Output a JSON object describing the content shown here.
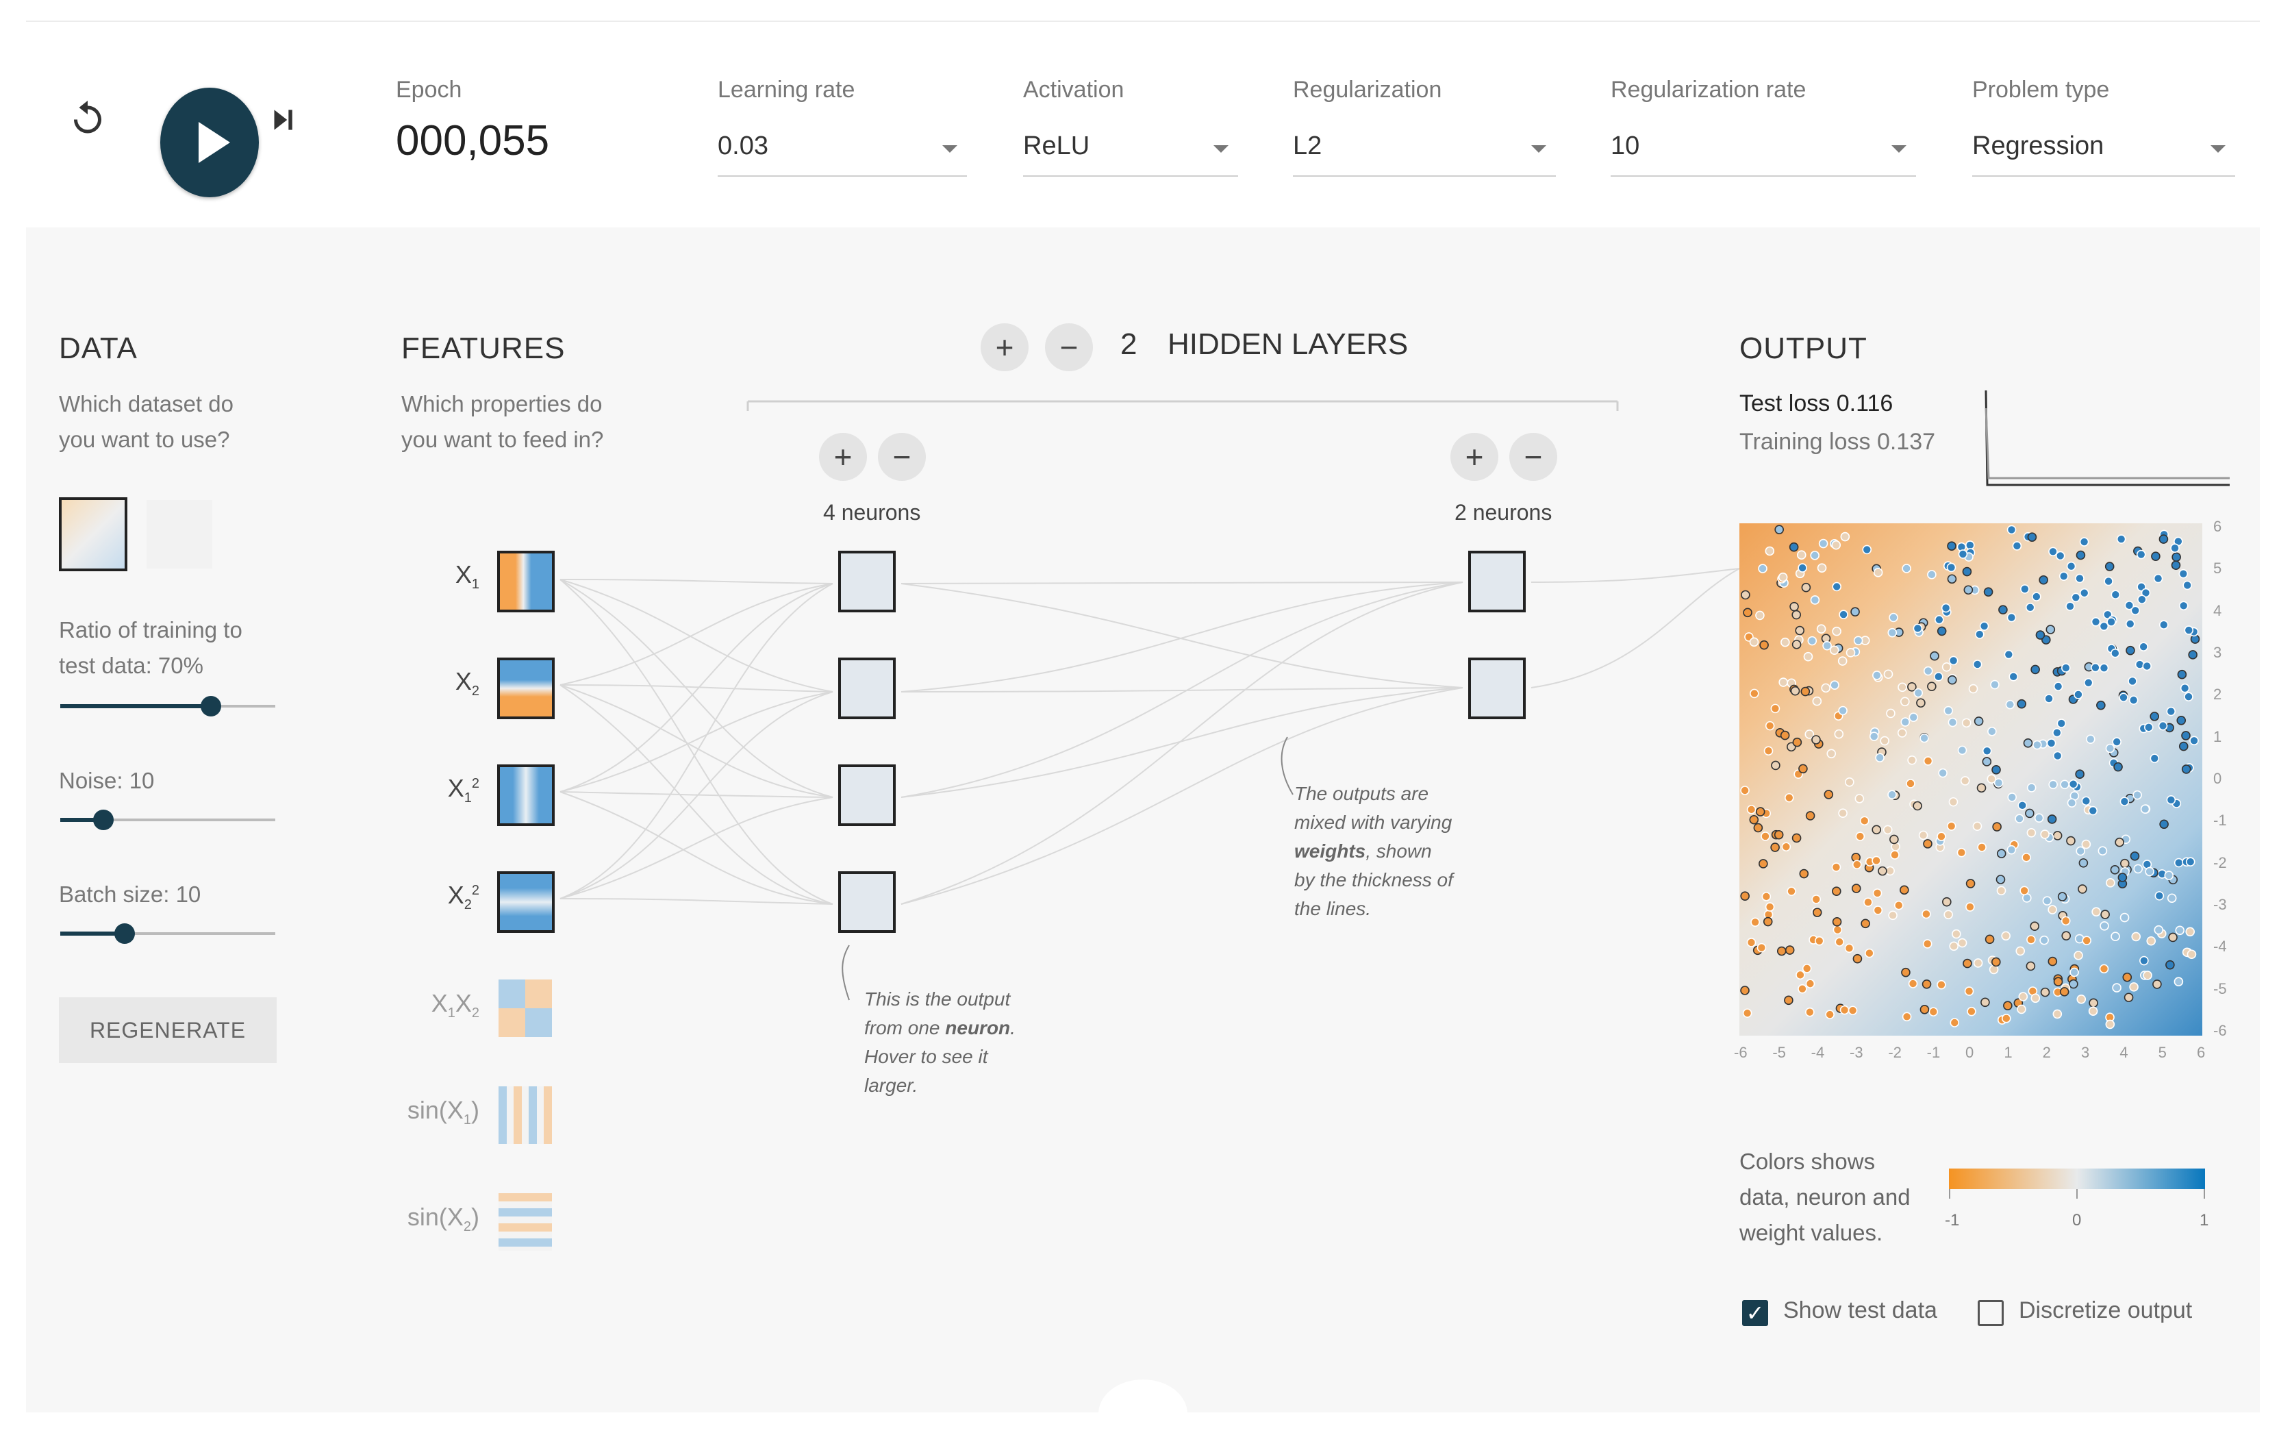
{
  "controls": {
    "epoch_label": "Epoch",
    "epoch_value": "000,055",
    "learning_rate": {
      "label": "Learning rate",
      "value": "0.03"
    },
    "activation": {
      "label": "Activation",
      "value": "ReLU"
    },
    "regularization": {
      "label": "Regularization",
      "value": "L2"
    },
    "regularization_rate": {
      "label": "Regularization rate",
      "value": "10"
    },
    "problem_type": {
      "label": "Problem type",
      "value": "Regression"
    }
  },
  "data_panel": {
    "title": "DATA",
    "question_line1": "Which dataset do",
    "question_line2": "you want to use?",
    "ratio_line1": "Ratio of training to",
    "ratio_line2": "test data:  70%",
    "ratio_value": 0.7,
    "noise_label": "Noise:  10",
    "noise_value": 0.2,
    "batch_label": "Batch size:  10",
    "batch_value": 0.3,
    "regenerate_label": "REGENERATE"
  },
  "features_panel": {
    "title": "FEATURES",
    "question_line1": "Which properties do",
    "question_line2": "you want to feed in?"
  },
  "network": {
    "add_layer": "+",
    "remove_layer": "−",
    "layer_count": "2",
    "layers_label": "HIDDEN LAYERS",
    "layer1_neurons": "4 neurons",
    "layer2_neurons": "2 neurons",
    "note_neuron_1": "This is the output",
    "note_neuron_2": "from one neuron.",
    "note_neuron_3": "Hover to see it",
    "note_neuron_4": "larger.",
    "note_weights_1": "The outputs are",
    "note_weights_2": "mixed with varying",
    "note_weights_3": "weights, shown",
    "note_weights_4": "by the thickness of",
    "note_weights_5": "the lines."
  },
  "output_panel": {
    "title": "OUTPUT",
    "test_loss_label": "Test loss",
    "test_loss_value": "0.116",
    "training_loss_label": "Training loss",
    "training_loss_value": "0.137",
    "y_ticks": [
      "6",
      "5",
      "4",
      "3",
      "2",
      "1",
      "0",
      "-1",
      "-2",
      "-3",
      "-4",
      "-5",
      "-6"
    ],
    "x_ticks": [
      "-6",
      "-5",
      "-4",
      "-3",
      "-2",
      "-1",
      "0",
      "1",
      "2",
      "3",
      "4",
      "5",
      "6"
    ],
    "legend_line1": "Colors shows",
    "legend_line2": "data, neuron and",
    "legend_line3": "weight values.",
    "legend_min": "-1",
    "legend_mid": "0",
    "legend_max": "1",
    "show_test_label": "Show test data",
    "show_test_checked": true,
    "discretize_label": "Discretize output",
    "discretize_checked": false
  },
  "colors": {
    "accent": "#183d4e",
    "negative": "#f59322",
    "neutral": "#e8eaeb",
    "positive": "#0877bd"
  }
}
